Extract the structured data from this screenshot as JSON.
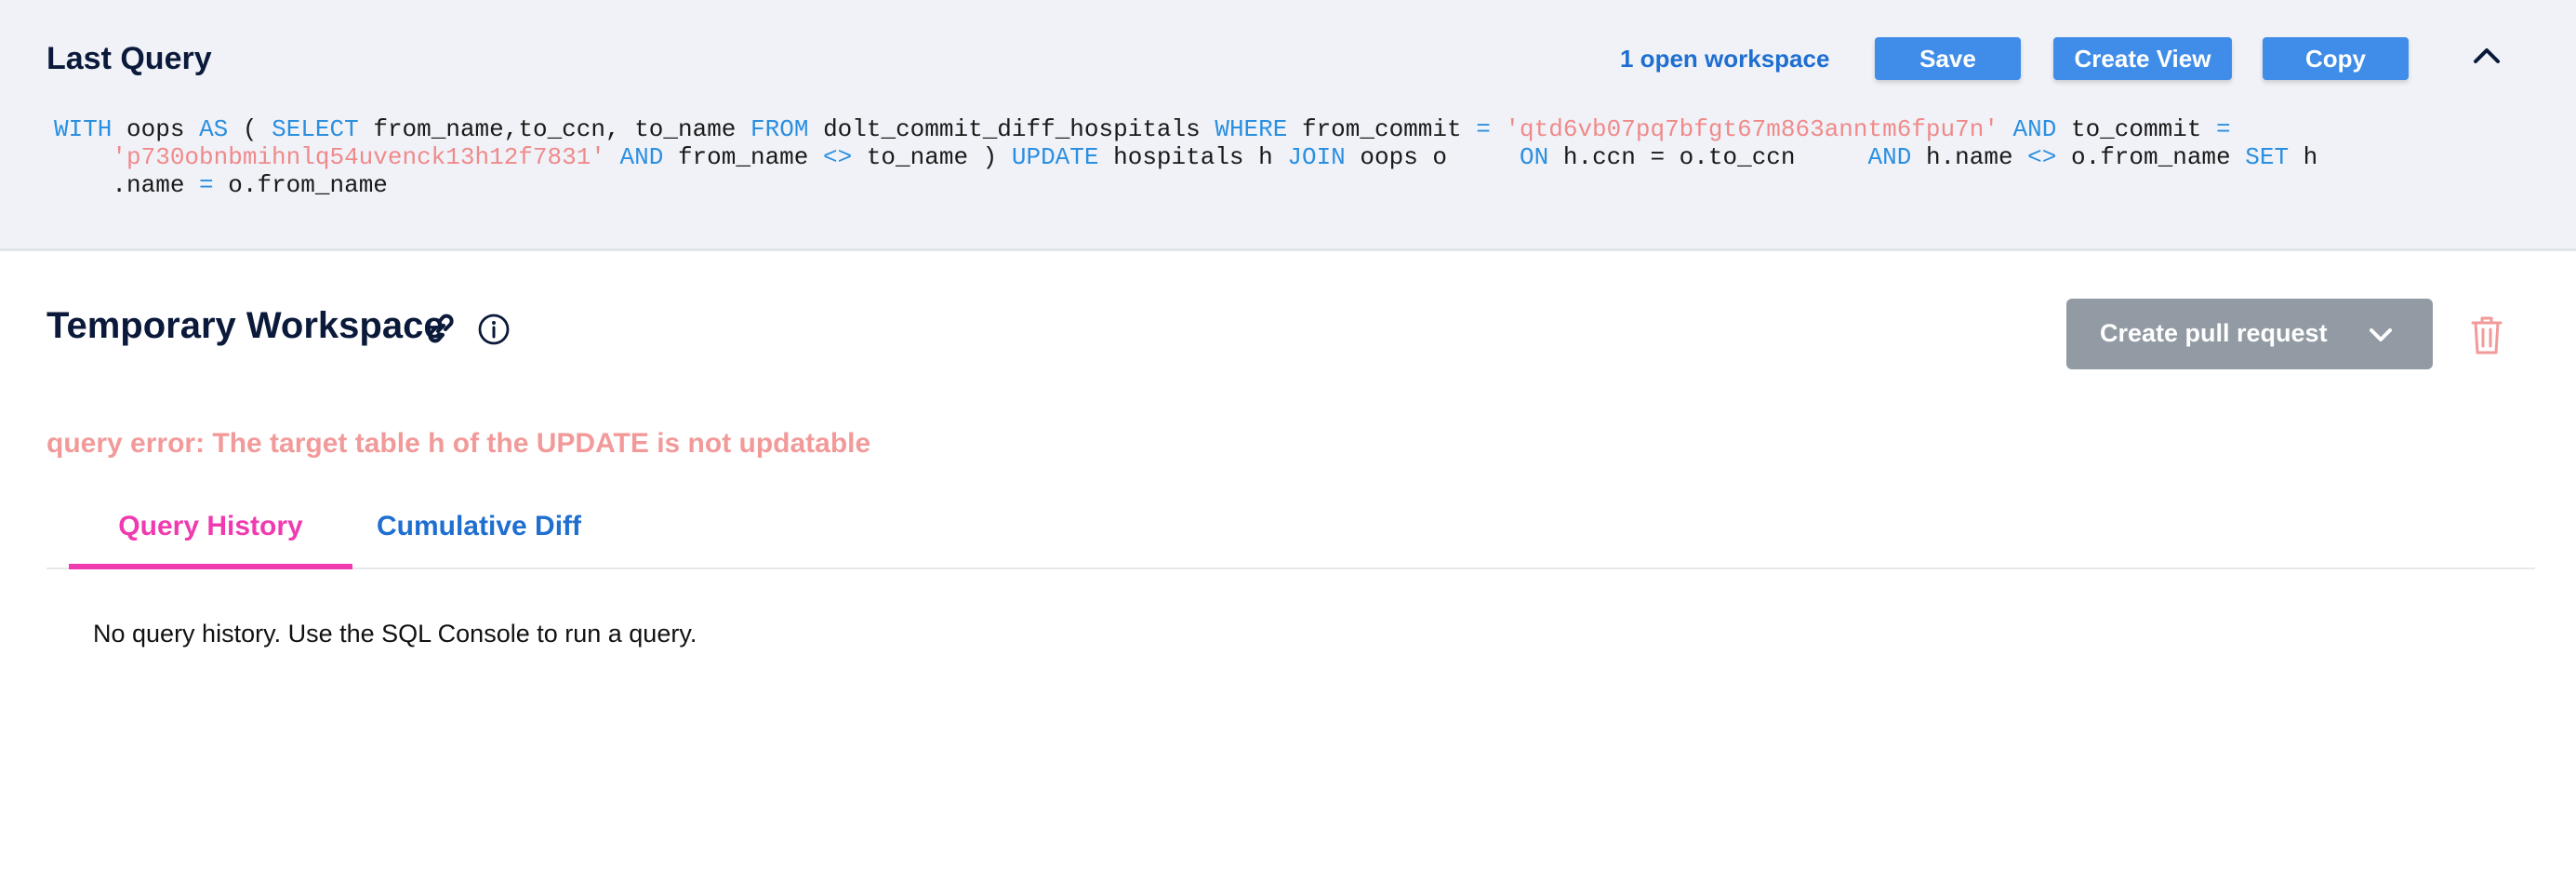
{
  "last_query": {
    "title": "Last Query",
    "open_workspace_link": "1 open workspace",
    "save_label": "Save",
    "create_view_label": "Create View",
    "copy_label": "Copy",
    "sql": {
      "with": "WITH",
      "cte_name": "oops",
      "as": "AS",
      "paren_open": "(",
      "select": "SELECT",
      "columns": "from_name,to_ccn, to_name",
      "from": "FROM",
      "table": "dolt_commit_diff_hospitals",
      "where": "WHERE",
      "from_commit_col": "from_commit",
      "eq": "=",
      "from_commit_val": "'qtd6vb07pq7bfgt67m863anntm6fpu7n'",
      "and": "AND",
      "to_commit_col": "to_commit",
      "to_commit_val": "'p730obnbmihnlq54uvenck13h12f7831'",
      "from_name_col": "from_name",
      "neq": "<>",
      "to_name_paren": "to_name )",
      "update": "UPDATE",
      "update_target": "hospitals h",
      "join": "JOIN",
      "join_target": "oops o",
      "on": "ON",
      "on_cond": "h.ccn = o.to_ccn",
      "h_name": "h.name",
      "o_from_name": "o.from_name",
      "set": "SET",
      "set_h": "h",
      "set_rest_prefix": ".name",
      "set_rest_val": "o.from_name"
    }
  },
  "workspace": {
    "title": "Temporary Workspace",
    "create_pr_label": "Create pull request",
    "error": "query error: The target table h of the UPDATE is not updatable"
  },
  "tabs": {
    "query_history": "Query History",
    "cumulative_diff": "Cumulative Diff"
  },
  "history": {
    "empty_message": "No query history. Use the SQL Console to run a query."
  },
  "colors": {
    "accent_blue": "#3f8de8",
    "link_blue": "#1f6fd0",
    "active_tab_pink": "#f03bb0",
    "error_red": "#f29a9a",
    "pr_button_gray": "#929ba3"
  },
  "icons": [
    "chevron-up-icon",
    "link-icon",
    "info-icon",
    "chevron-down-icon",
    "trash-icon"
  ]
}
